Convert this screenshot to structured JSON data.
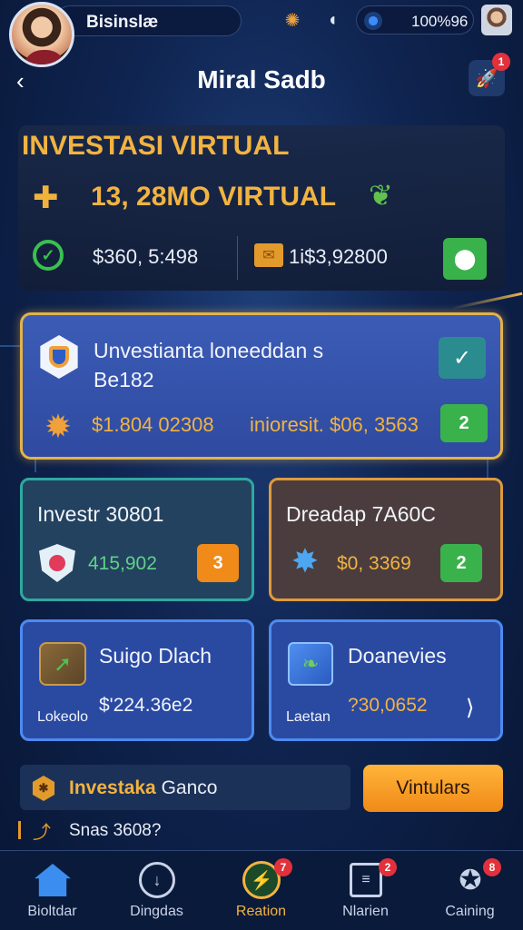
{
  "status_bar": {
    "app_label": "Bisinslæ",
    "battery_text": "100%96"
  },
  "header": {
    "title": "Miral Sadb",
    "notification_count": "1"
  },
  "summary": {
    "title": "INVESTASI VIRTUAL",
    "total": "13, 28MO VIRTUAL",
    "value_left": "$360, 5:498",
    "value_right": "1i$3,92800"
  },
  "main_card": {
    "title_line1": "Unvestianta loneeddan s",
    "title_line2": "Be182",
    "amount": "$1.804 02308",
    "interest": "inioresit. $06, 3563",
    "button_number": "2"
  },
  "cards": {
    "teal": {
      "title": "Investr 30801",
      "value": "415,902",
      "button_number": "3"
    },
    "brown": {
      "title": "Dreadap  7A60C",
      "value": "$0, 3369",
      "button_number": "2"
    },
    "blue": {
      "title": "Suigo Dlach",
      "label": "Lokeolo",
      "value": "$'224.36e2"
    },
    "blue2": {
      "title": "Doanevies",
      "label": "Laetan",
      "value": "?30,0652"
    }
  },
  "strip": {
    "text_accent": "Investaka",
    "text_rest": " Ganco",
    "button_label": "Vintulars",
    "sub_text": "Snas 3608?"
  },
  "nav": [
    {
      "label": "Bioltdar",
      "badge": ""
    },
    {
      "label": "Dingdas",
      "badge": ""
    },
    {
      "label": "Reation",
      "badge": "7"
    },
    {
      "label": "Nlarien",
      "badge": "2"
    },
    {
      "label": "Caining",
      "badge": "8"
    }
  ],
  "colors": {
    "background": "#0f2450",
    "gold": "#f2b341",
    "green": "#3ab24c",
    "orange": "#f08a18",
    "badge_red": "#e2313b"
  },
  "icons": [
    "coin-icon",
    "leaf-icon",
    "check-icon",
    "envelope-icon",
    "location-icon",
    "hexagon-icon",
    "gear-icon",
    "shield-icon",
    "sun-icon",
    "box-icon",
    "cube-icon",
    "home-icon",
    "award-icon"
  ]
}
